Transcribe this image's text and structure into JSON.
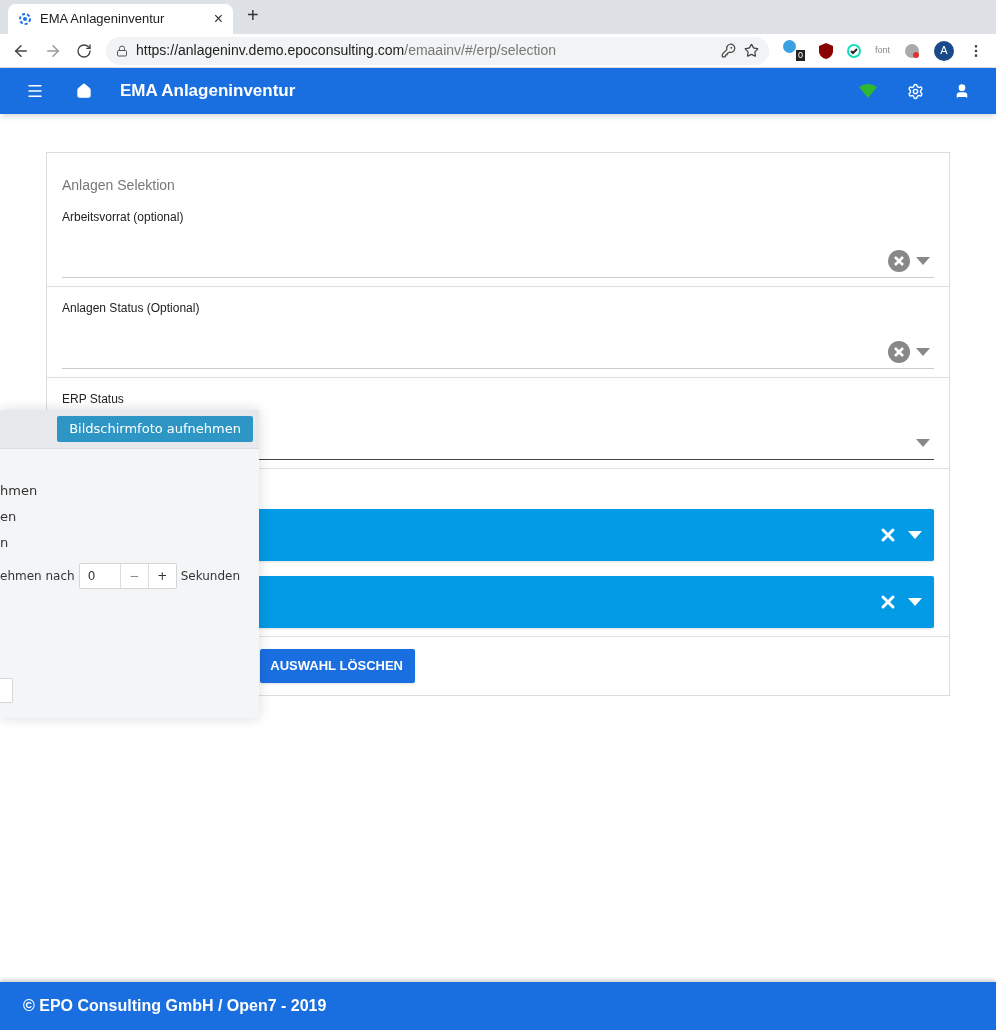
{
  "browser": {
    "tab": {
      "title": "EMA Anlageninventur",
      "close": "×",
      "new_tab": "+"
    },
    "url": {
      "host": "https://anlageninv.demo.epoconsulting.com",
      "path": "/emaainv/#/erp/selection"
    },
    "extension_badge": "0",
    "extension_text": "font",
    "avatar": "A"
  },
  "app_bar": {
    "title": "EMA Anlageninventur"
  },
  "card": {
    "title": "Anlagen Selektion",
    "fields": [
      {
        "label": "Arbeitsvorrat (optional)",
        "clearable": true,
        "focused": false
      },
      {
        "label": "Anlagen Status (Optional)",
        "clearable": true,
        "focused": false
      },
      {
        "label": "ERP Status",
        "clearable": false,
        "focused": true
      }
    ],
    "chips": [
      {
        "clearable": true
      },
      {
        "clearable": true
      }
    ],
    "button": "AUSWAHL LÖSCHEN"
  },
  "overlay": {
    "button": "Bildschirmfoto aufnehmen",
    "lines": [
      "hmen",
      "en",
      "n"
    ],
    "delay_label": "ehmen nach",
    "delay_value": "0",
    "minus": "−",
    "plus": "+",
    "unit": "Sekunden"
  },
  "footer": "© EPO Consulting GmbH / Open7 - 2019"
}
